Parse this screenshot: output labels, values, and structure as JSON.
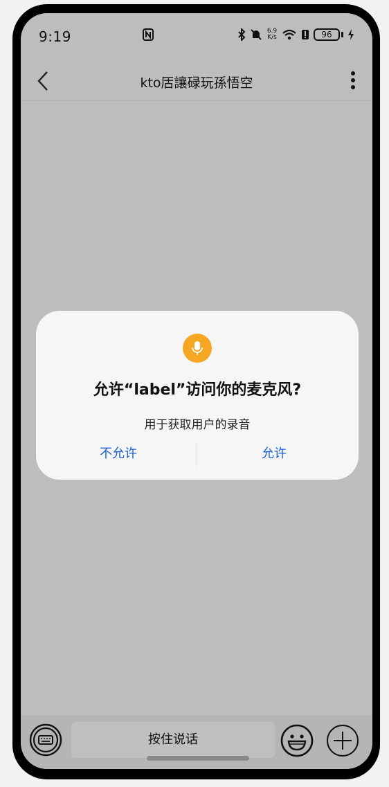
{
  "status_bar": {
    "time": "9:19",
    "battery": "96",
    "net_speed_top": "6.9",
    "net_speed_unit": "K/s"
  },
  "header": {
    "title": "kto㕆讓碌玩孫悟空"
  },
  "dialog": {
    "title": "允许“label”访问你的麦克风?",
    "description": "用于获取用户的录音",
    "deny_label": "不允许",
    "allow_label": "允许",
    "icon": "microphone-icon",
    "accent_color": "#f5a623",
    "button_color": "#1a5fd6"
  },
  "bottom_bar": {
    "hold_to_talk_label": "按住说话"
  }
}
